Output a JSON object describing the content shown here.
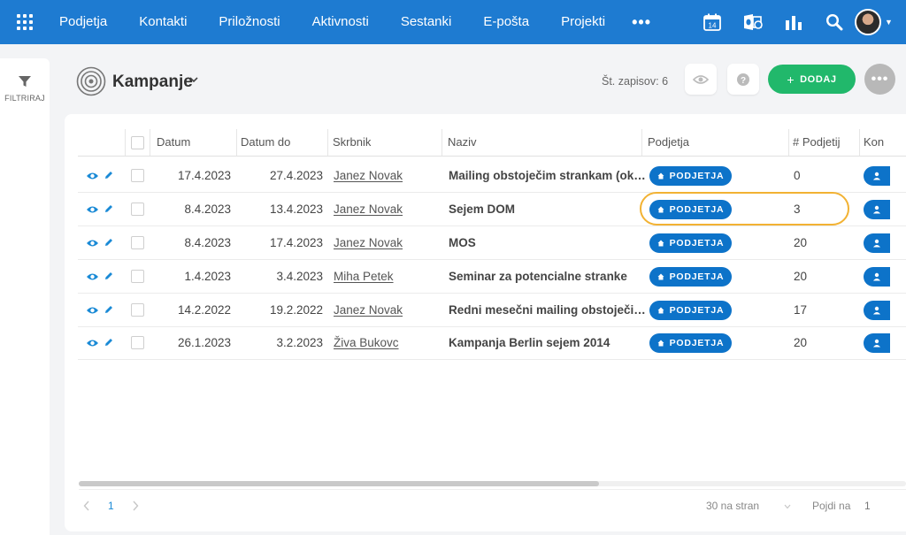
{
  "nav": {
    "items": [
      "Podjetja",
      "Kontakti",
      "Priložnosti",
      "Aktivnosti",
      "Sestanki",
      "E-pošta",
      "Projekti"
    ],
    "more": "•••",
    "calendar_day": "14"
  },
  "sidebar": {
    "filter_label": "FILTRIRAJ"
  },
  "header": {
    "title": "Kampanje",
    "record_count": "Št. zapisov: 6",
    "add_label": "DODAJ",
    "add_symbol": "+",
    "more_symbol": "•••"
  },
  "table": {
    "columns": [
      "Datum",
      "Datum do",
      "Skrbnik",
      "Naziv",
      "Podjetja",
      "# Podjetij",
      "Kon"
    ],
    "rows": [
      {
        "datum": "17.4.2023",
        "datum_do": "27.4.2023",
        "skrbnik": "Janez Novak",
        "naziv": "Mailing obstoječim strankam (ok…",
        "podjetja": "PODJETJA",
        "st": "0"
      },
      {
        "datum": "8.4.2023",
        "datum_do": "13.4.2023",
        "skrbnik": "Janez Novak",
        "naziv": "Sejem DOM",
        "podjetja": "PODJETJA",
        "st": "3"
      },
      {
        "datum": "8.4.2023",
        "datum_do": "17.4.2023",
        "skrbnik": "Janez Novak",
        "naziv": "MOS",
        "podjetja": "PODJETJA",
        "st": "20"
      },
      {
        "datum": "1.4.2023",
        "datum_do": "3.4.2023",
        "skrbnik": "Miha Petek",
        "naziv": "Seminar za potencialne stranke",
        "podjetja": "PODJETJA",
        "st": "20"
      },
      {
        "datum": "14.2.2022",
        "datum_do": "19.2.2022",
        "skrbnik": "Janez Novak",
        "naziv": "Redni mesečni mailing obstoječi…",
        "podjetja": "PODJETJA",
        "st": "17"
      },
      {
        "datum": "26.1.2023",
        "datum_do": "3.2.2023",
        "skrbnik": "Živa Bukovc",
        "naziv": "Kampanja Berlin sejem 2014",
        "podjetja": "PODJETJA",
        "st": "20"
      }
    ]
  },
  "pagination": {
    "current_page": "1",
    "per_page": "30 na stran",
    "goto_label": "Pojdi na",
    "goto_value": "1"
  },
  "colors": {
    "topbar": "#1e7bd1",
    "accent_blue": "#0d73c9",
    "add_green": "#21b86b",
    "highlight": "#f2b233",
    "icon_blue": "#1a8ad6"
  }
}
